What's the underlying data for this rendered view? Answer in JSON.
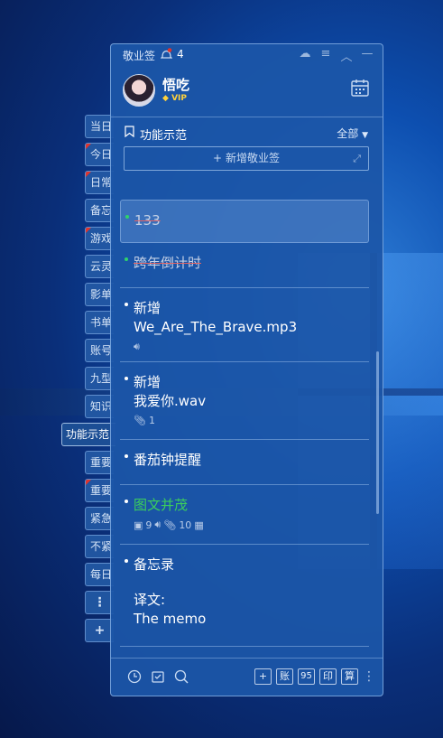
{
  "side_tabs": [
    {
      "label": "当日",
      "flag": false
    },
    {
      "label": "今日",
      "flag": true
    },
    {
      "label": "日常",
      "flag": true
    },
    {
      "label": "备忘",
      "flag": false
    },
    {
      "label": "游戏",
      "flag": true
    },
    {
      "label": "云灵",
      "flag": false
    },
    {
      "label": "影单",
      "flag": false
    },
    {
      "label": "书单",
      "flag": false
    },
    {
      "label": "账号",
      "flag": false
    },
    {
      "label": "九型",
      "flag": false
    },
    {
      "label": "知识",
      "flag": false
    },
    {
      "label": "功能示范",
      "active": true
    },
    {
      "label": "重要",
      "flag": false
    },
    {
      "label": "重要",
      "flag": true
    },
    {
      "label": "紧急",
      "flag": false
    },
    {
      "label": "不紧",
      "flag": false
    },
    {
      "label": "每日",
      "flag": false
    },
    {
      "label": "⋮"
    },
    {
      "label": "+"
    }
  ],
  "titlebar": {
    "app_title": "敬业签",
    "notification_count": "4"
  },
  "user": {
    "name": "悟吃",
    "badge": "VIP"
  },
  "category": {
    "name": "功能示范",
    "filter": "全部"
  },
  "add_button": "新增敬业签",
  "items": [
    {
      "title": "133",
      "done": true
    },
    {
      "title": "跨年倒计时",
      "done": true
    },
    {
      "title": "新增",
      "sub": "We_Are_The_Brave.mp3",
      "meta": "audio"
    },
    {
      "title": "新增",
      "sub": "我爱你.wav",
      "meta": "attach",
      "attach_count": "1"
    },
    {
      "title": "番茄钟提醒"
    },
    {
      "title": "图文并茂",
      "green": true,
      "image_count": "9",
      "attach_count": "10"
    },
    {
      "title": "备忘录",
      "sub2": "译文:",
      "sub3": "The memo"
    }
  ],
  "footer": {
    "right_buttons": [
      "+",
      "账",
      "95",
      "印",
      "算"
    ]
  },
  "colors": {
    "panel": "#1c56a8",
    "done_dot": "#2fd36a",
    "green_title": "#3bcf5c",
    "vip": "#ffd23c",
    "bell_badge": "#e2332b"
  }
}
